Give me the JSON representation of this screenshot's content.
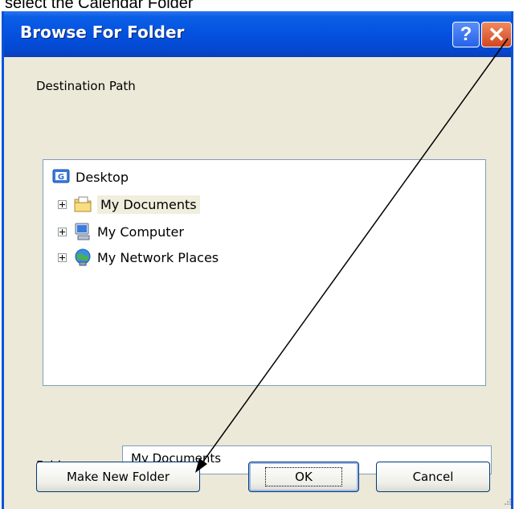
{
  "caption": "select the Calendar Folder",
  "dialog": {
    "title": "Browse For Folder",
    "help_label": "?",
    "close_label": "✕",
    "description": "Destination Path"
  },
  "tree": {
    "items": [
      {
        "label": "Desktop",
        "icon": "desktop-icon"
      },
      {
        "label": "My Documents",
        "icon": "folder-documents-icon",
        "selected": true
      },
      {
        "label": "My Computer",
        "icon": "computer-icon"
      },
      {
        "label": "My Network Places",
        "icon": "network-places-icon"
      }
    ]
  },
  "folder_field": {
    "label": "Folder:",
    "value": "My Documents"
  },
  "buttons": {
    "make_new_folder": "Make New Folder",
    "ok": "OK",
    "cancel": "Cancel"
  },
  "colors": {
    "titlebar": "#0451df",
    "dialog_bg": "#ece9d8",
    "close": "#d2451f"
  }
}
